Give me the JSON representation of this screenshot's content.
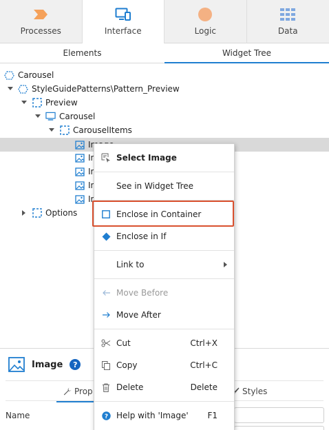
{
  "top_tabs": [
    {
      "label": "Processes",
      "icon": "processes-icon",
      "color": "#f5a15a"
    },
    {
      "label": "Interface",
      "icon": "interface-icon",
      "color": "#1f7ed0"
    },
    {
      "label": "Logic",
      "icon": "logic-icon",
      "color": "#f4b183"
    },
    {
      "label": "Data",
      "icon": "data-icon",
      "color": "#5b8fd6"
    }
  ],
  "sub_tabs": [
    {
      "label": "Elements"
    },
    {
      "label": "Widget Tree"
    }
  ],
  "tree": {
    "root": "Carousel",
    "block": "StyleGuidePatterns\\Pattern_Preview",
    "preview": "Preview",
    "carousel": "Carousel",
    "carousel_items": "CarouselItems",
    "images": [
      "Image",
      "In",
      "In",
      "In",
      "In"
    ],
    "options": "Options"
  },
  "context_menu": {
    "select_image": "Select Image",
    "see_in_tree": "See in Widget Tree",
    "enclose_container": "Enclose in Container",
    "enclose_if": "Enclose in If",
    "link_to": "Link to",
    "move_before": "Move Before",
    "move_after": "Move After",
    "cut": "Cut",
    "cut_shortcut": "Ctrl+X",
    "copy": "Copy",
    "copy_shortcut": "Ctrl+C",
    "delete": "Delete",
    "delete_shortcut": "Delete",
    "help": "Help with 'Image'",
    "help_shortcut": "F1"
  },
  "properties": {
    "title": "Image",
    "tab_props": "Prop",
    "tab_styles": "Styles",
    "name_label": "Name"
  },
  "colors": {
    "accent": "#1f7ed0",
    "highlight_border": "#d9502e",
    "selected_row": "#d9d9d9"
  }
}
